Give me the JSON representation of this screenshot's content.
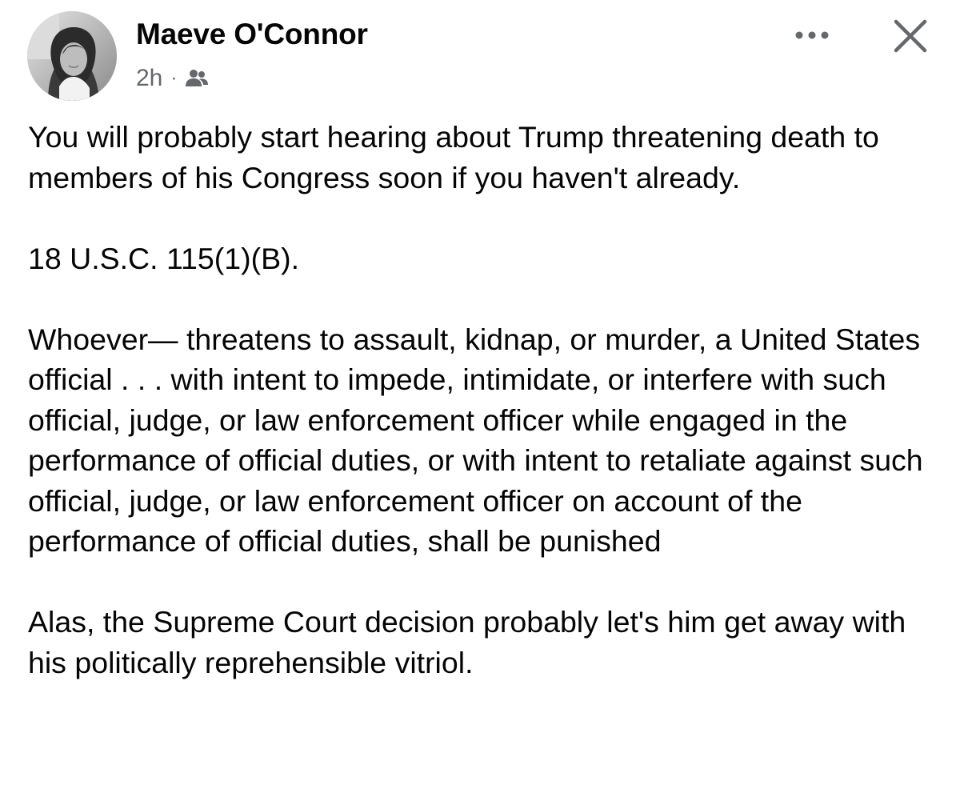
{
  "post": {
    "author_name": "Maeve O'Connor",
    "timestamp": "2h",
    "separator": "·",
    "audience_icon": "friends-icon",
    "more_icon": "more-horizontal-icon",
    "close_icon": "close-icon",
    "avatar": "profile-photo-avatar",
    "paragraphs": [
      "You will probably start hearing about Trump threatening death to members of his Congress soon if you haven't already.",
      "18 U.S.C. 115(1)(B).",
      "Whoever— threatens to assault, kidnap, or murder, a United States official . . . with intent to impede, intimidate, or interfere with such official, judge, or law enforcement officer while engaged in the performance of official duties, or with intent to retaliate against such official, judge, or law enforcement officer on account of the performance of official duties, shall be punished",
      "Alas, the Supreme Court decision probably let's him get away with his politically reprehensible vitriol."
    ]
  },
  "colors": {
    "text": "#050505",
    "secondary_text": "#65676b",
    "background": "#ffffff"
  }
}
